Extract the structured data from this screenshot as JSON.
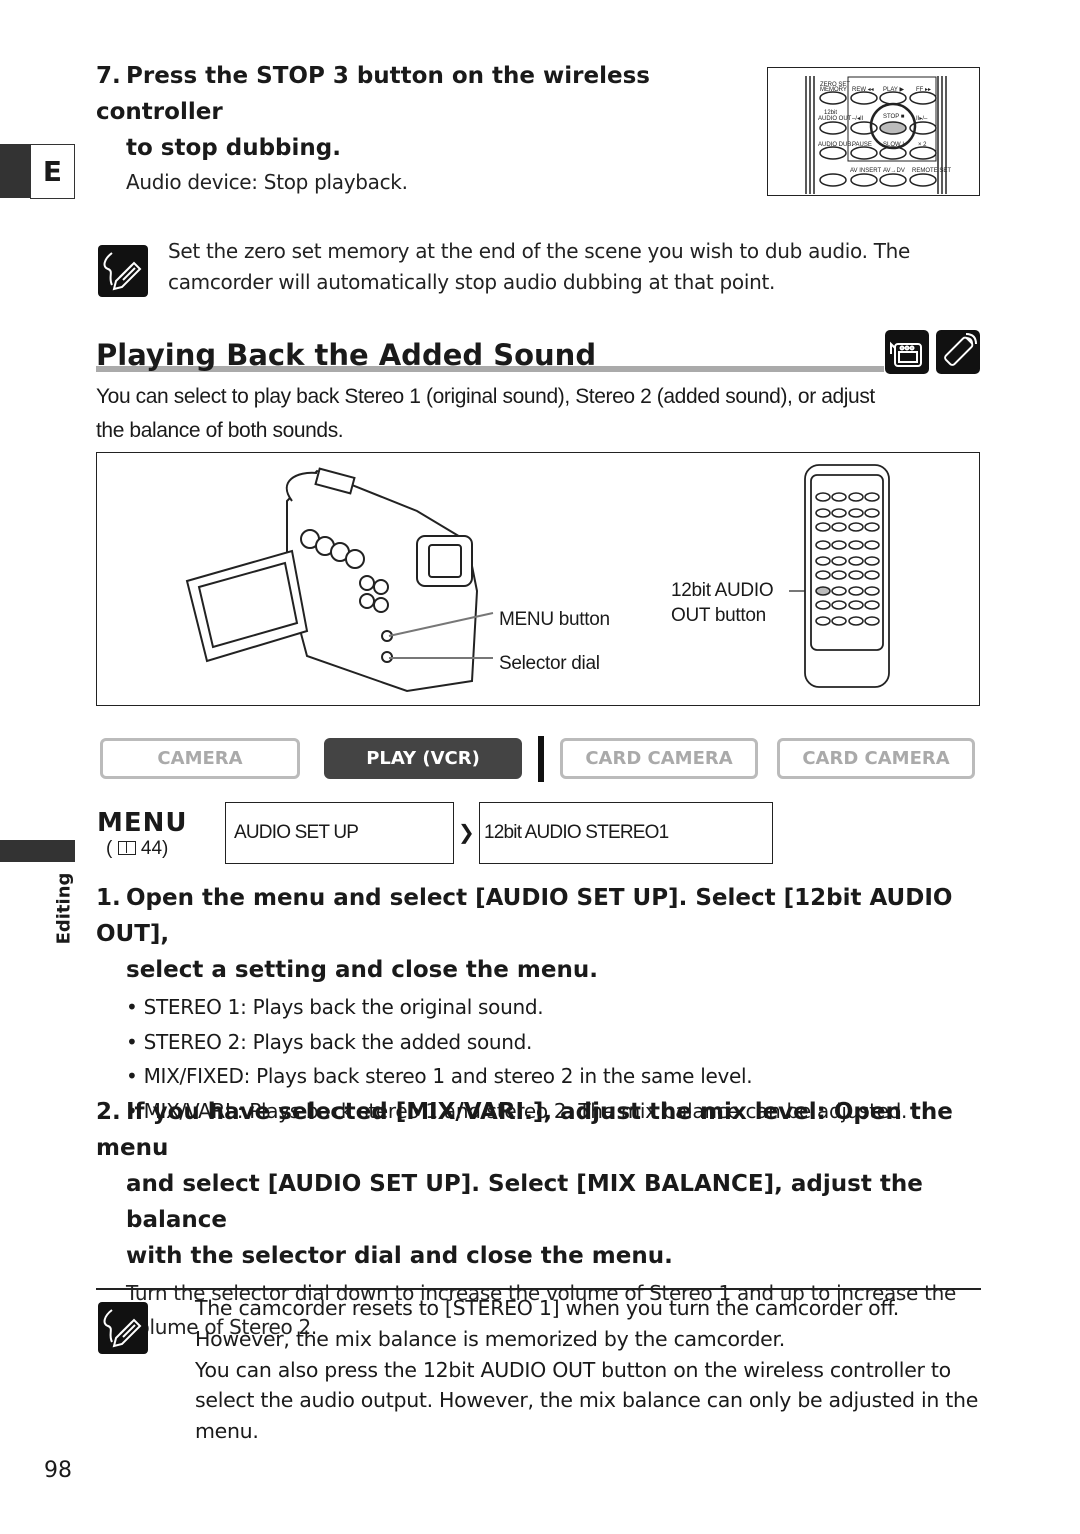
{
  "side_tab": {
    "letter": "E",
    "section": "Editing"
  },
  "step7": {
    "number": "7.",
    "line1": "Press the STOP 3  button on the wireless controller",
    "line2": "to stop dubbing.",
    "detail": "Audio device: Stop playback."
  },
  "remote_thumb": {
    "labels": [
      "ZERO SET MEMORY",
      "REW",
      "PLAY",
      "FF",
      "12bit AUDIO OUT",
      "STOP",
      "AUDIO DUB.",
      "PAUSE",
      "SLOW",
      "× 2",
      "AV INSERT",
      "AV→DV",
      "REMOTE SET"
    ],
    "highlighted": "STOP"
  },
  "note1": {
    "icon": "pencil-note-icon",
    "text": "Set the zero set memory at the end of the scene you wish to dub audio. The camcorder will automatically stop audio dubbing at that point."
  },
  "section": {
    "title": "Playing Back the Added Sound",
    "icons": [
      "camcorder-icon",
      "remote-control-icon"
    ],
    "intro_line1": "You can select to play back Stereo 1 (original sound), Stereo 2 (added sound), or adjust",
    "intro_line2": "the balance of both sounds."
  },
  "figure": {
    "menu_button_label": "MENU button",
    "selector_dial_label": "Selector dial",
    "audio_out_label_1": "12bit AUDIO",
    "audio_out_label_2": "OUT button"
  },
  "modes": [
    {
      "label": "CAMERA",
      "active": false
    },
    {
      "label": "PLAY (VCR)",
      "active": true
    },
    {
      "label": "CARD CAMERA",
      "active": false
    },
    {
      "label": "CARD CAMERA",
      "active": false
    }
  ],
  "menu": {
    "word": "MENU",
    "ref": "( 44)",
    "ref_page": "44",
    "path": [
      "AUDIO SET UP",
      "12bit AUDIO STEREO1"
    ]
  },
  "step1": {
    "number": "1.",
    "line1": "Open the menu and select [AUDIO SET UP]. Select [12bit AUDIO OUT],",
    "line2": "select a setting and close the menu.",
    "bullets": [
      "STEREO 1: Plays back the original sound.",
      "STEREO 2: Plays back the added sound.",
      "MIX/FIXED: Plays back stereo 1 and stereo 2 in the same level.",
      "MIX/VARI.: Plays back stereo 1 and stereo 2. The mix balance can be adjusted."
    ]
  },
  "step2": {
    "number": "2.",
    "line1": "If you have selected [MIX/VARI.], adjust the mix level: Open the menu",
    "line2": "and select [AUDIO SET UP]. Select [MIX BALANCE], adjust the balance",
    "line3": "with the selector dial and close the menu.",
    "detail1": "Turn the selector dial down to increase the volume of Stereo 1 and up to increase the",
    "detail2": "volume of Stereo 2."
  },
  "note2": {
    "icon": "pencil-note-icon",
    "lines": [
      "The camcorder resets to [STEREO 1] when you turn the camcorder off.",
      "However, the mix balance is memorized by the camcorder.",
      "You can also press the 12bit AUDIO OUT button on the wireless controller to",
      "select the audio output. However, the mix balance can only be adjusted in the",
      "menu."
    ]
  },
  "page_number": "98"
}
